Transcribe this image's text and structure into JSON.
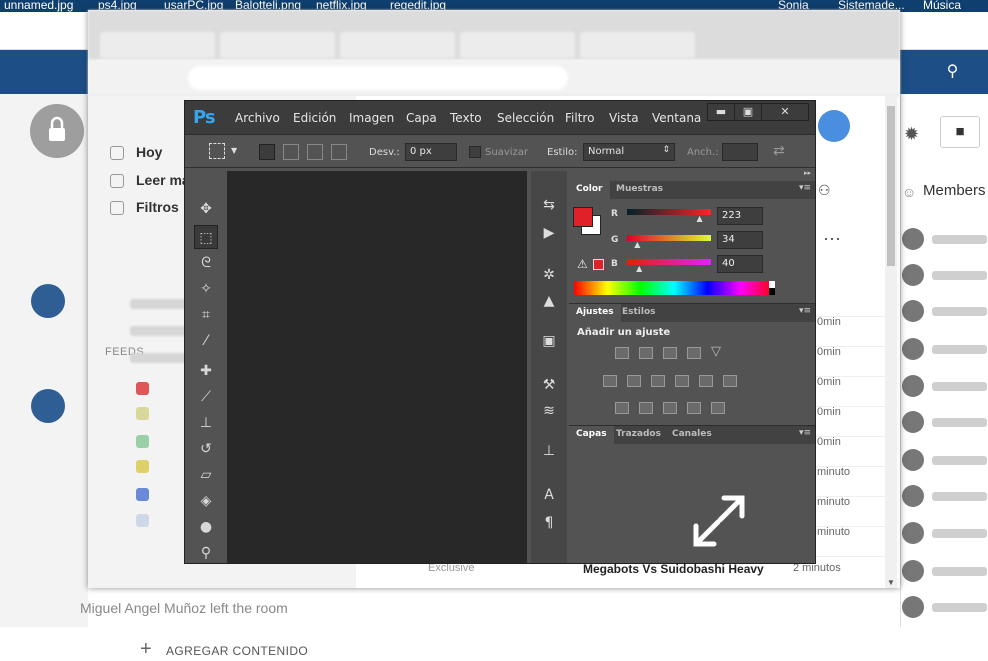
{
  "desktop": {
    "files": [
      "unnamed.jpg",
      "ps4.jpg",
      "usarPC.jpg",
      "Balotteli.png",
      "netflix.jpg",
      "regedit.jpg",
      "Sonia",
      "Sistemade...",
      "Música"
    ]
  },
  "feed_sidebar": {
    "items": [
      "Hoy",
      "Leer más tarde",
      "Filtros"
    ],
    "feeds_label": "FEEDS",
    "add_content": "AGREGAR CONTENIDO"
  },
  "main": {
    "times": [
      "0min",
      "0min",
      "0min",
      "0min",
      "0min",
      "minuto",
      "minuto",
      "minuto",
      "minuto"
    ],
    "last_row_title": "Megabots Vs Suidobashi Heavy",
    "last_row_time": "2 minutos",
    "last_row_source": "Exclusive"
  },
  "chat": {
    "members_label": "Members",
    "left_room": "Miguel Angel Muñoz left the room"
  },
  "photoshop": {
    "logo": "Ps",
    "menu": [
      "Archivo",
      "Edición",
      "Imagen",
      "Capa",
      "Texto",
      "Selección",
      "Filtro",
      "Vista",
      "Ventana"
    ],
    "window_buttons": [
      "▬",
      "▣",
      "✕"
    ],
    "options": {
      "feather_label": "Desv.:",
      "feather_value": "0 px",
      "smooth_label": "Suavizar",
      "style_label": "Estilo:",
      "style_value": "Normal",
      "width_label": "Anch.:"
    },
    "color_panel": {
      "tabs": [
        "Color",
        "Muestras"
      ],
      "foreground_color": "#df2228",
      "r": "223",
      "g": "34",
      "b": "40",
      "r_label": "R",
      "g_label": "G",
      "b_label": "B"
    },
    "adjust_panel": {
      "tabs": [
        "Ajustes",
        "Estilos"
      ],
      "title": "Añadir un ajuste"
    },
    "layers_panel": {
      "tabs": [
        "Capas",
        "Trazados",
        "Canales"
      ]
    }
  }
}
